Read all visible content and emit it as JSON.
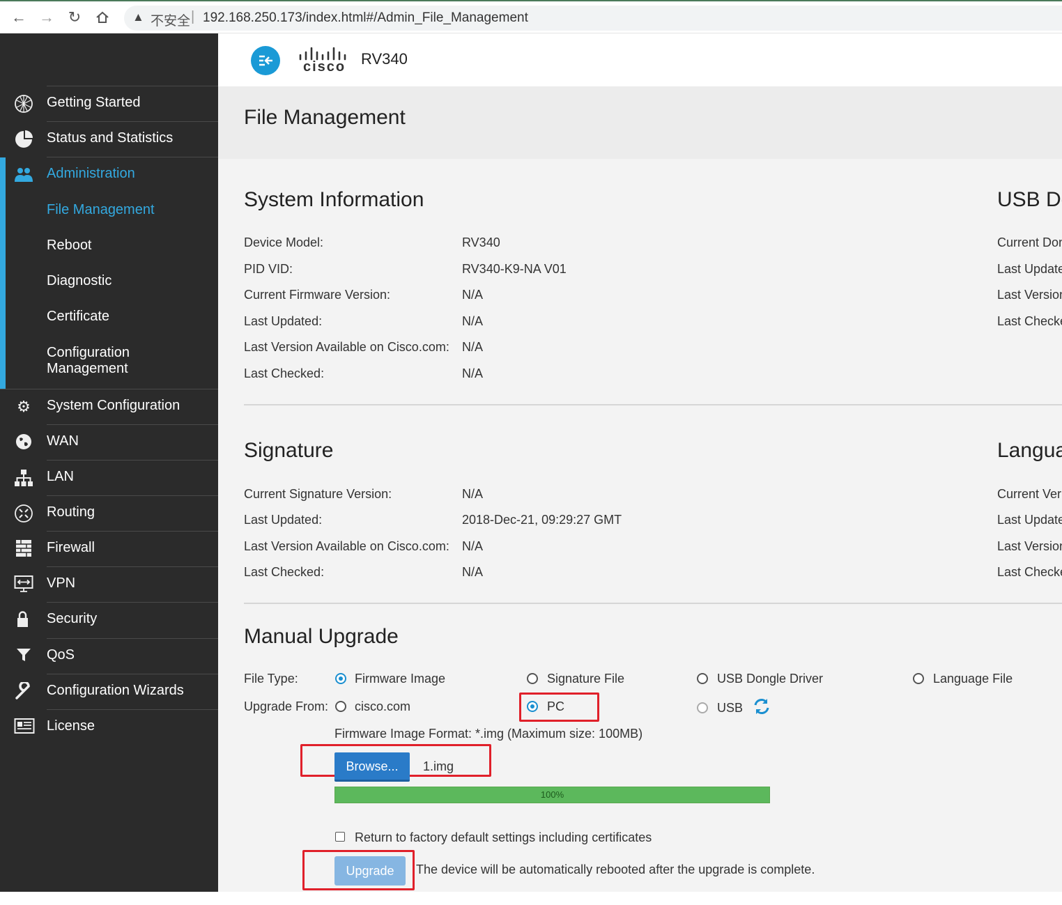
{
  "browser": {
    "insecure_label": "不安全",
    "url": "192.168.250.173/index.html#/Admin_File_Management"
  },
  "header": {
    "model": "RV340",
    "logo_text": "cisco"
  },
  "sidebar": {
    "items": [
      {
        "label": "Getting Started",
        "icon": "globe-icon"
      },
      {
        "label": "Status and Statistics",
        "icon": "pie-chart-icon"
      },
      {
        "label": "Administration",
        "icon": "users-icon"
      },
      {
        "label": "System Configuration",
        "icon": "gear-icon"
      },
      {
        "label": "WAN",
        "icon": "globe-icon"
      },
      {
        "label": "LAN",
        "icon": "network-icon"
      },
      {
        "label": "Routing",
        "icon": "routing-icon"
      },
      {
        "label": "Firewall",
        "icon": "firewall-icon"
      },
      {
        "label": "VPN",
        "icon": "vpn-icon"
      },
      {
        "label": "Security",
        "icon": "lock-icon"
      },
      {
        "label": "QoS",
        "icon": "filter-icon"
      },
      {
        "label": "Configuration Wizards",
        "icon": "wrench-icon"
      },
      {
        "label": "License",
        "icon": "license-icon"
      }
    ],
    "admin_sub": [
      "File Management",
      "Reboot",
      "Diagnostic",
      "Certificate",
      "Configuration",
      "Management"
    ],
    "accent_color": "#33a9e0"
  },
  "page": {
    "title": "File Management"
  },
  "system_info": {
    "title": "System Information",
    "rows": [
      {
        "label": "Device Model:",
        "value": "RV340"
      },
      {
        "label": "PID VID:",
        "value": "RV340-K9-NA V01"
      },
      {
        "label": "Current Firmware Version:",
        "value": "N/A"
      },
      {
        "label": "Last Updated:",
        "value": "N/A"
      },
      {
        "label": "Last Version Available on Cisco.com:",
        "value": "N/A"
      },
      {
        "label": "Last Checked:",
        "value": "N/A"
      }
    ]
  },
  "usb": {
    "title": "USB Do",
    "rows": [
      "Current Don",
      "Last Update",
      "Last Version",
      "Last Checke"
    ]
  },
  "signature": {
    "title": "Signature",
    "rows": [
      {
        "label": "Current Signature Version:",
        "value": "N/A"
      },
      {
        "label": "Last Updated:",
        "value": "2018-Dec-21, 09:29:27 GMT"
      },
      {
        "label": "Last Version Available on Cisco.com:",
        "value": "N/A"
      },
      {
        "label": "Last Checked:",
        "value": "N/A"
      }
    ]
  },
  "language": {
    "title": "Langua",
    "rows": [
      "Current Ver",
      "Last Update",
      "Last Version",
      "Last Checke"
    ]
  },
  "manual_upgrade": {
    "title": "Manual Upgrade",
    "file_type_label": "File Type:",
    "file_types": [
      "Firmware Image",
      "Signature File",
      "USB Dongle Driver",
      "Language File"
    ],
    "selected_file_type": "Firmware Image",
    "upgrade_from_label": "Upgrade From:",
    "upgrade_from": [
      "cisco.com",
      "PC",
      "USB"
    ],
    "selected_upgrade_from": "PC",
    "format_note": "Firmware Image Format: *.img (Maximum size: 100MB)",
    "browse_label": "Browse...",
    "file_name": "1.img",
    "progress_percent": 100,
    "progress_text": "100%",
    "factory_default_label": "Return to factory default settings including certificates",
    "factory_default_checked": false,
    "upgrade_label": "Upgrade",
    "reboot_note": "The device will be automatically rebooted after the upgrade is complete.",
    "highlight_color": "#e0202a",
    "progress_color": "#5cb85c"
  }
}
